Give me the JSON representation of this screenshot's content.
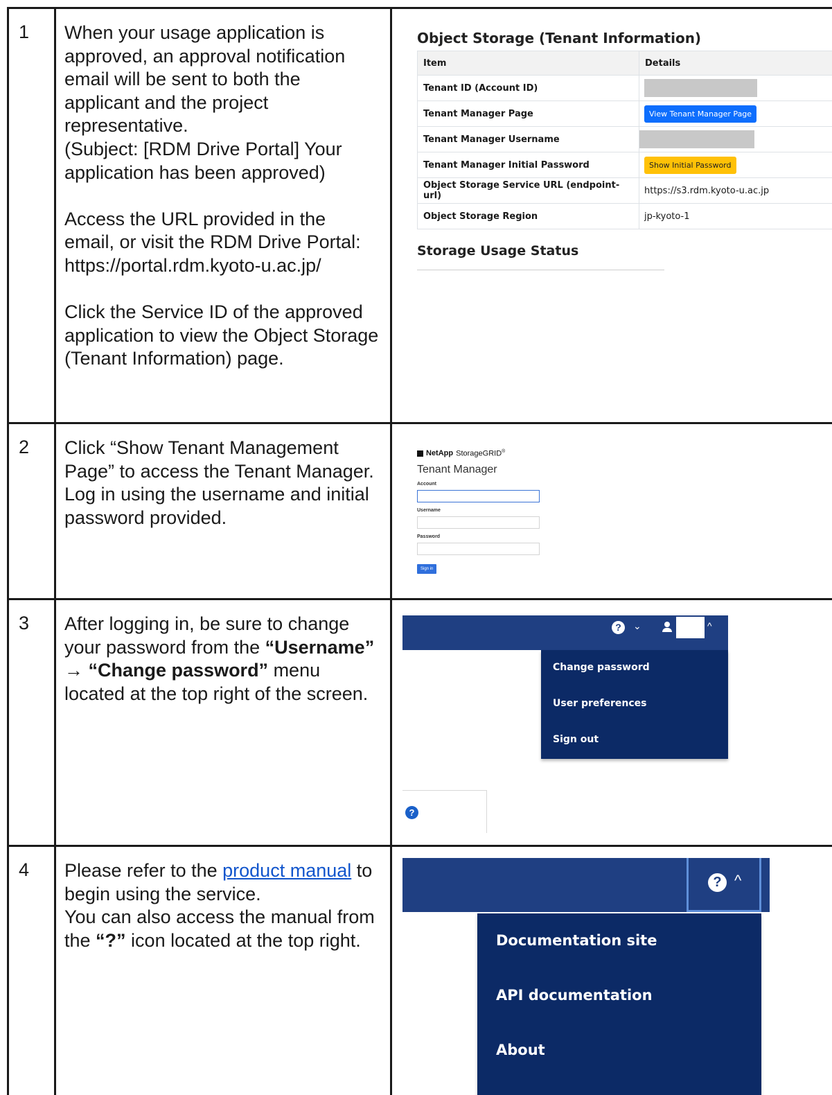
{
  "rows": [
    {
      "num": "1",
      "paras": [
        "When your usage application is approved, an approval notification email will be sent to both the applicant and the project representative.",
        "(Subject: [RDM Drive Portal] Your application has been approved)",
        "Access the URL provided in the email, or visit the RDM Drive Portal:",
        "https://portal.rdm.kyoto-u.ac.jp/",
        "Click the Service ID of the approved application to view the Object Storage (Tenant Information) page."
      ]
    },
    {
      "num": "2",
      "paras": [
        "Click “Show Tenant Management Page” to access the Tenant Manager.",
        "Log in using the username and initial password provided."
      ]
    },
    {
      "num": "3",
      "text_before": "After logging in, be sure to change your password from the ",
      "bold1": "“Username”",
      "arrow": " → ",
      "bold2": "“Change password”",
      "text_after": " menu located at the top right of the screen."
    },
    {
      "num": "4",
      "text_before": "Please refer to the ",
      "link": "product manual",
      "text_mid": " to begin using the service.",
      "text2_before": "You can also access the manual from the ",
      "bold": "“?”",
      "text2_after": " icon located at the top right."
    }
  ],
  "object_storage": {
    "title": "Object Storage (Tenant Information)",
    "col_item": "Item",
    "col_details": "Details",
    "rows": [
      {
        "key": "Tenant ID (Account ID)",
        "value": ""
      },
      {
        "key": "Tenant Manager Page",
        "value": "View Tenant Manager Page"
      },
      {
        "key": "Tenant Manager Username",
        "value": ""
      },
      {
        "key": "Tenant Manager Initial Password",
        "value": "Show Initial Password"
      },
      {
        "key": "Object Storage Service URL (endpoint-url)",
        "value": "https://s3.rdm.kyoto-u.ac.jp"
      },
      {
        "key": "Object Storage Region",
        "value": "jp-kyoto-1"
      }
    ],
    "usage_title": "Storage Usage Status"
  },
  "login": {
    "brand": "NetApp",
    "product": "StorageGRID",
    "reg": "®",
    "title": "Tenant Manager",
    "account_label": "Account",
    "username_label": "Username",
    "password_label": "Password",
    "signin": "Sign in"
  },
  "user_menu": {
    "help_glyph": "?",
    "chevron_down": "⌄",
    "chevron_up": "^",
    "items": [
      "Change password",
      "User preferences",
      "Sign out"
    ]
  },
  "help_menu": {
    "help_glyph": "?",
    "chevron_up": "^",
    "items": [
      "Documentation site",
      "API documentation",
      "About"
    ]
  }
}
